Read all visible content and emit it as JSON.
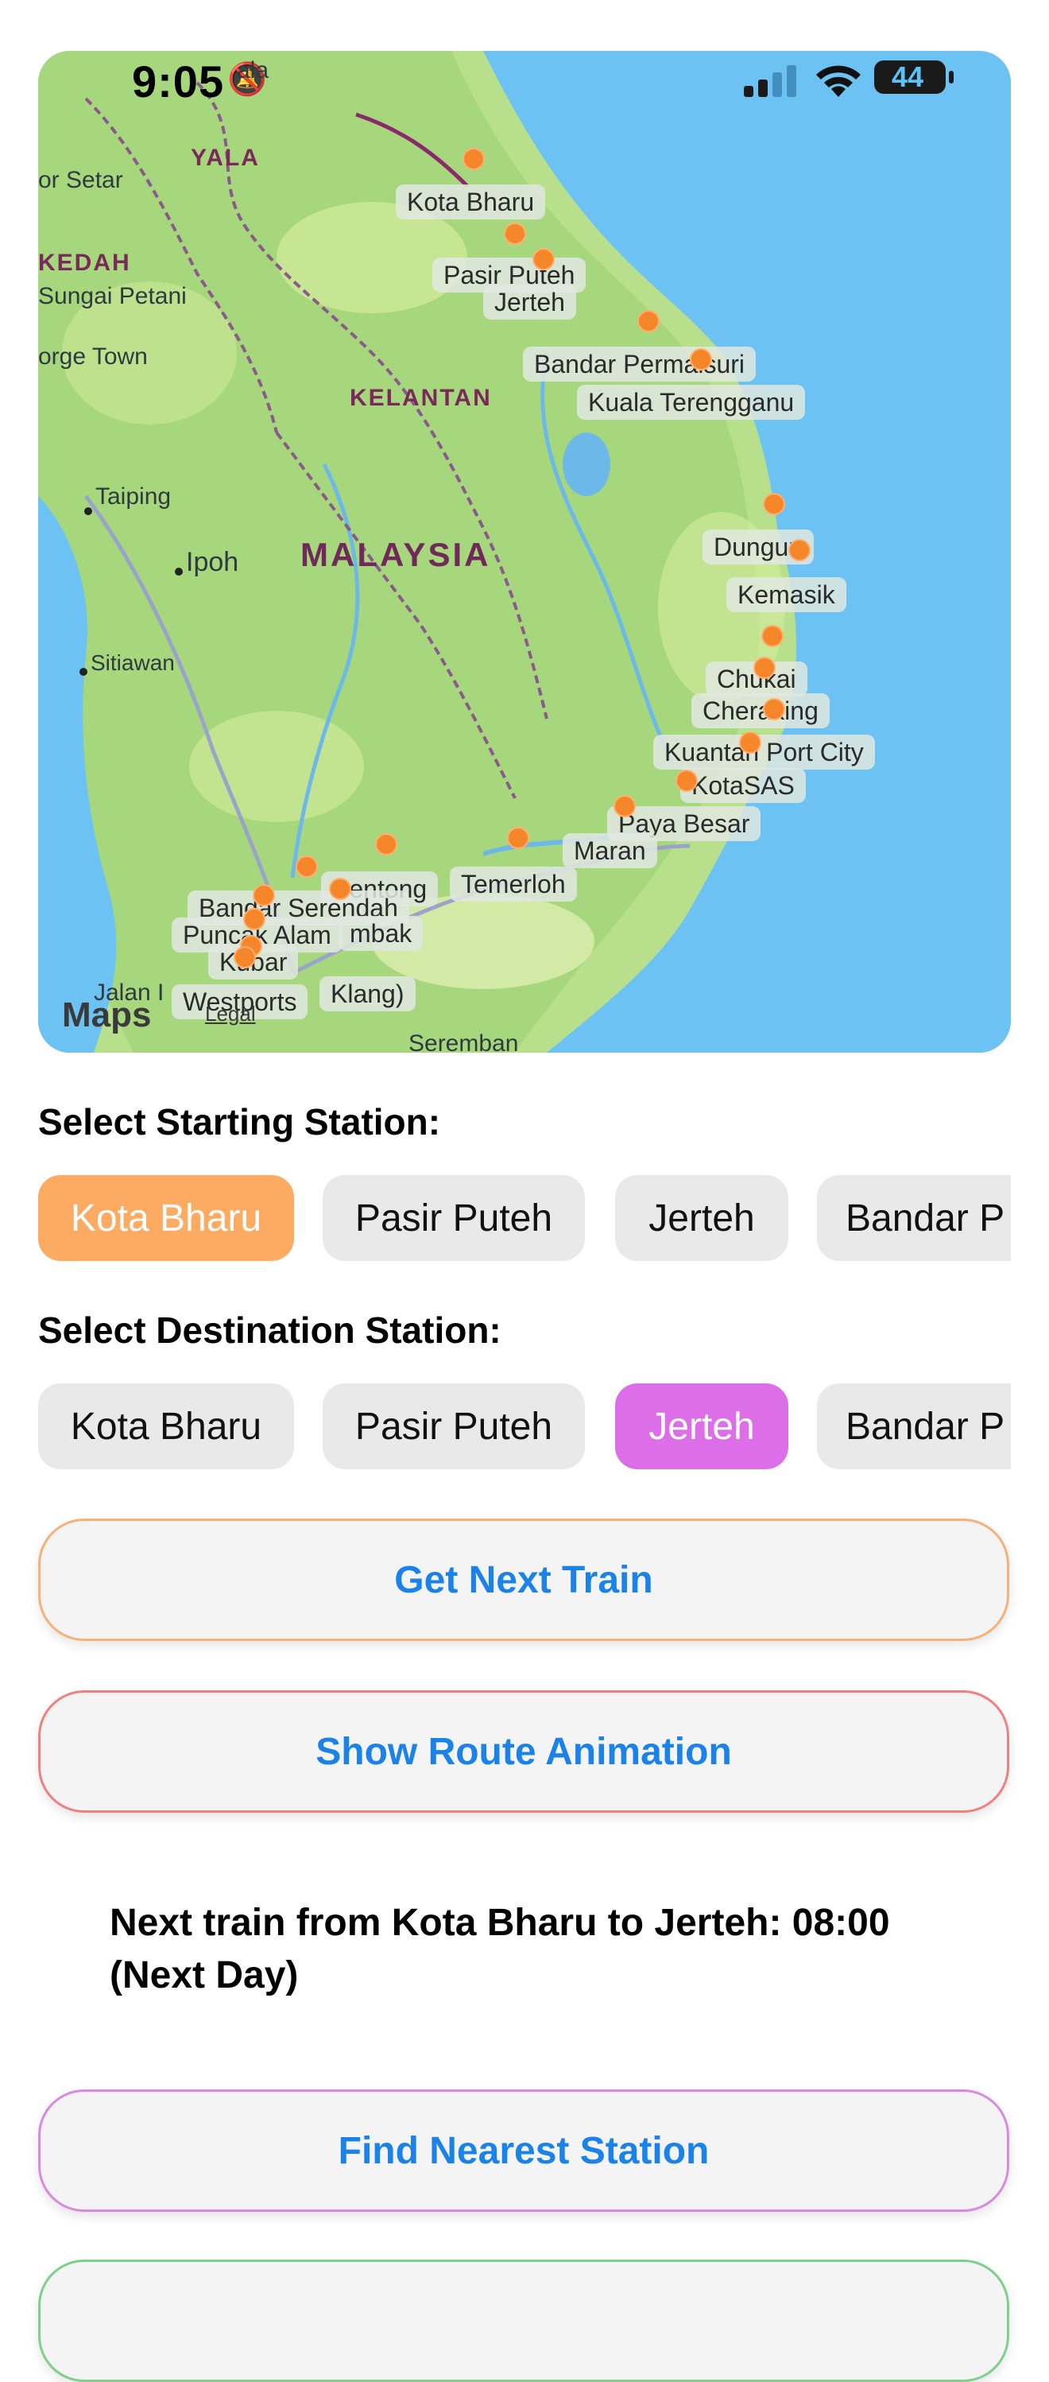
{
  "status_bar": {
    "time": "9:05",
    "battery": "44"
  },
  "map": {
    "attribution": {
      "logo": "Maps",
      "legal": "Legal"
    },
    "country_label": "MALAYSIA",
    "region_labels": [
      "YALA",
      "KEDAH",
      "KELANTAN"
    ],
    "place_labels": [
      "ala",
      "or Setar",
      "Sungai Petani",
      "orge Town",
      "Taiping",
      "Ipoh",
      "Sitiawan",
      "Jalan I",
      "Seremban"
    ],
    "station_labels": [
      "Kota Bharu",
      "Pasir Puteh",
      "Jerteh",
      "Bandar Permaisuri",
      "Kuala Terengganu",
      "Dungun",
      "Kemasik",
      "Chukai",
      "Cheraking",
      "Kuantan Port City",
      "KotaSAS",
      "Paya Besar",
      "Maran",
      "Temerloh",
      "Bentong",
      "Bandar Serendah",
      "Puncak Alam",
      "mbak",
      "Kubar",
      "Westports",
      "Klang)"
    ]
  },
  "start_section": {
    "title": "Select Starting Station:",
    "stations": [
      "Kota Bharu",
      "Pasir Puteh",
      "Jerteh",
      "Bandar P"
    ],
    "selected": "Kota Bharu"
  },
  "dest_section": {
    "title": "Select Destination Station:",
    "stations": [
      "Kota Bharu",
      "Pasir Puteh",
      "Jerteh",
      "Bandar P"
    ],
    "selected": "Jerteh"
  },
  "actions": {
    "next_train": "Get Next Train",
    "route_animation": "Show Route Animation",
    "nearest_station": "Find Nearest Station"
  },
  "result_text": "Next train from Kota Bharu to Jerteh: 08:00 (Next Day)",
  "colors": {
    "start_selected": "#fdab63",
    "dest_selected": "#dc6ee8",
    "action_text": "#1a82e8",
    "next_train_border": "#f4b27a",
    "route_border": "#ee8080",
    "nearest_border": "#d68ae0",
    "station_dot": "#f5862a"
  },
  "icons": [
    "bell-slash-icon",
    "cellular-signal-icon",
    "wifi-icon",
    "battery-icon",
    "apple-logo-icon"
  ]
}
